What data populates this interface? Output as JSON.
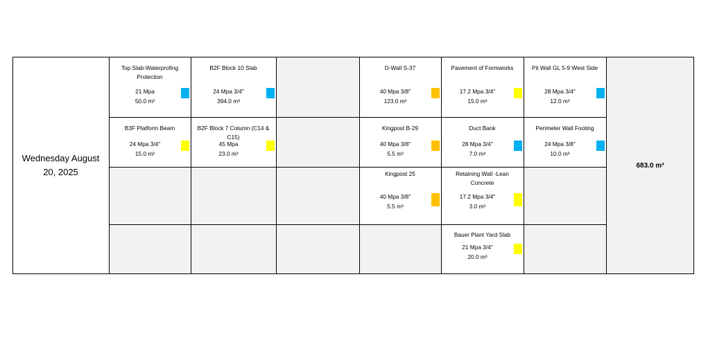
{
  "date": {
    "line1": "Wednesday  August",
    "line2": "20, 2025"
  },
  "total": "683.0 m³",
  "colors": {
    "blue": "#00b0f0",
    "yellow": "#ffff00",
    "orange": "#ffc000",
    "gray_cell": "#f2f2f2"
  },
  "cells": [
    {
      "id": "r0c0",
      "name": "Top Slab-Waterprofing Protection",
      "mpa": "21 Mpa",
      "volume": "50.0 m³",
      "color": "blue"
    },
    {
      "id": "r0c1",
      "name": "B2F Block 10  Slab",
      "mpa": "24 Mpa 3/4\"",
      "volume": "394.0 m³",
      "color": "blue"
    },
    {
      "id": "r0c3",
      "name": "D-Wall S-37",
      "mpa": "40 Mpa 3/8\"",
      "volume": "123.0 m³",
      "color": "orange"
    },
    {
      "id": "r0c4",
      "name": "Pavement of Formworks",
      "mpa": "17.2 Mpa 3/4\"",
      "volume": "15.0 m³",
      "color": "yellow"
    },
    {
      "id": "r0c5",
      "name": "Pit Wall GL 5-9  West Side",
      "mpa": "28 Mpa 3/4\"",
      "volume": "12.0 m³",
      "color": "blue"
    },
    {
      "id": "r1c0",
      "name": "B3F Platform Beam",
      "mpa": "24 Mpa 3/4\"",
      "volume": "15.0 m³",
      "color": "yellow"
    },
    {
      "id": "r1c1",
      "name": "B2F Block 7 Column (C14 & C15)",
      "mpa": "45 Mpa",
      "volume": "23.0 m³",
      "color": "yellow"
    },
    {
      "id": "r1c3",
      "name": "Kingpost B-29",
      "mpa": "40 Mpa 3/8\"",
      "volume": "5.5 m³",
      "color": "orange"
    },
    {
      "id": "r1c4",
      "name": "Duct Bank",
      "mpa": "28 Mpa 3/4\"",
      "volume": "7.0 m³",
      "color": "blue"
    },
    {
      "id": "r1c5",
      "name": "Perimeter Wall Footing",
      "mpa": "24 Mpa 3/8\"",
      "volume": "10.0 m³",
      "color": "blue"
    },
    {
      "id": "r2c3",
      "name": "Kingpost 25",
      "mpa": "40 Mpa 3/8\"",
      "volume": "5.5 m³",
      "color": "orange"
    },
    {
      "id": "r2c4",
      "name": "Retaining Wall -Lean Concrete",
      "mpa": "17.2 Mpa 3/4\"",
      "volume": "3.0 m³",
      "color": "yellow"
    },
    {
      "id": "r3c4",
      "name": "Bauer Plant Yard Slab",
      "mpa": "21 Mpa 3/4\"",
      "volume": "20.0 m³",
      "color": "yellow"
    }
  ]
}
